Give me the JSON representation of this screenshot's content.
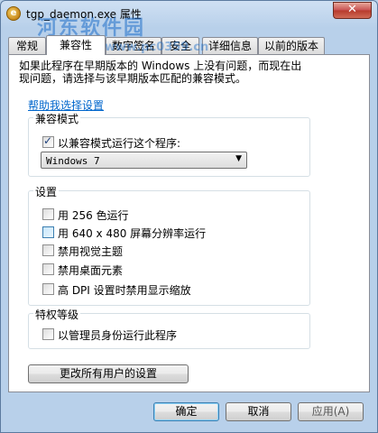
{
  "window": {
    "title": "tgp_daemon.exe 属性",
    "app_icon": "e",
    "close_symbol": "✕",
    "watermark": "河东软件园",
    "watermark_url": "www.pc0359.cn"
  },
  "tabs": [
    {
      "label": "常规"
    },
    {
      "label": "兼容性"
    },
    {
      "label": "数字签名"
    },
    {
      "label": "安全"
    },
    {
      "label": "详细信息"
    },
    {
      "label": "以前的版本"
    }
  ],
  "intro": {
    "line1": "如果此程序在早期版本的 Windows 上没有问题，而现在出",
    "line2": "现问题，请选择与该早期版本匹配的兼容模式。"
  },
  "help_link": "帮助我选择设置",
  "compat_mode": {
    "group_label": "兼容模式",
    "checkbox_label": "以兼容模式运行这个程序:",
    "checked": true,
    "selected_os": "Windows 7"
  },
  "settings": {
    "group_label": "设置",
    "options": [
      {
        "label": "用 256 色运行",
        "checked": false
      },
      {
        "label": "用 640 x 480 屏幕分辨率运行",
        "checked": false
      },
      {
        "label": "禁用视觉主题",
        "checked": false
      },
      {
        "label": "禁用桌面元素",
        "checked": false
      },
      {
        "label": "高 DPI 设置时禁用显示缩放",
        "checked": false
      }
    ]
  },
  "privilege": {
    "group_label": "特权等级",
    "checkbox_label": "以管理员身份运行此程序",
    "checked": false
  },
  "buttons": {
    "change_all": "更改所有用户的设置",
    "ok": "确定",
    "cancel": "取消",
    "apply": "应用(A)"
  }
}
